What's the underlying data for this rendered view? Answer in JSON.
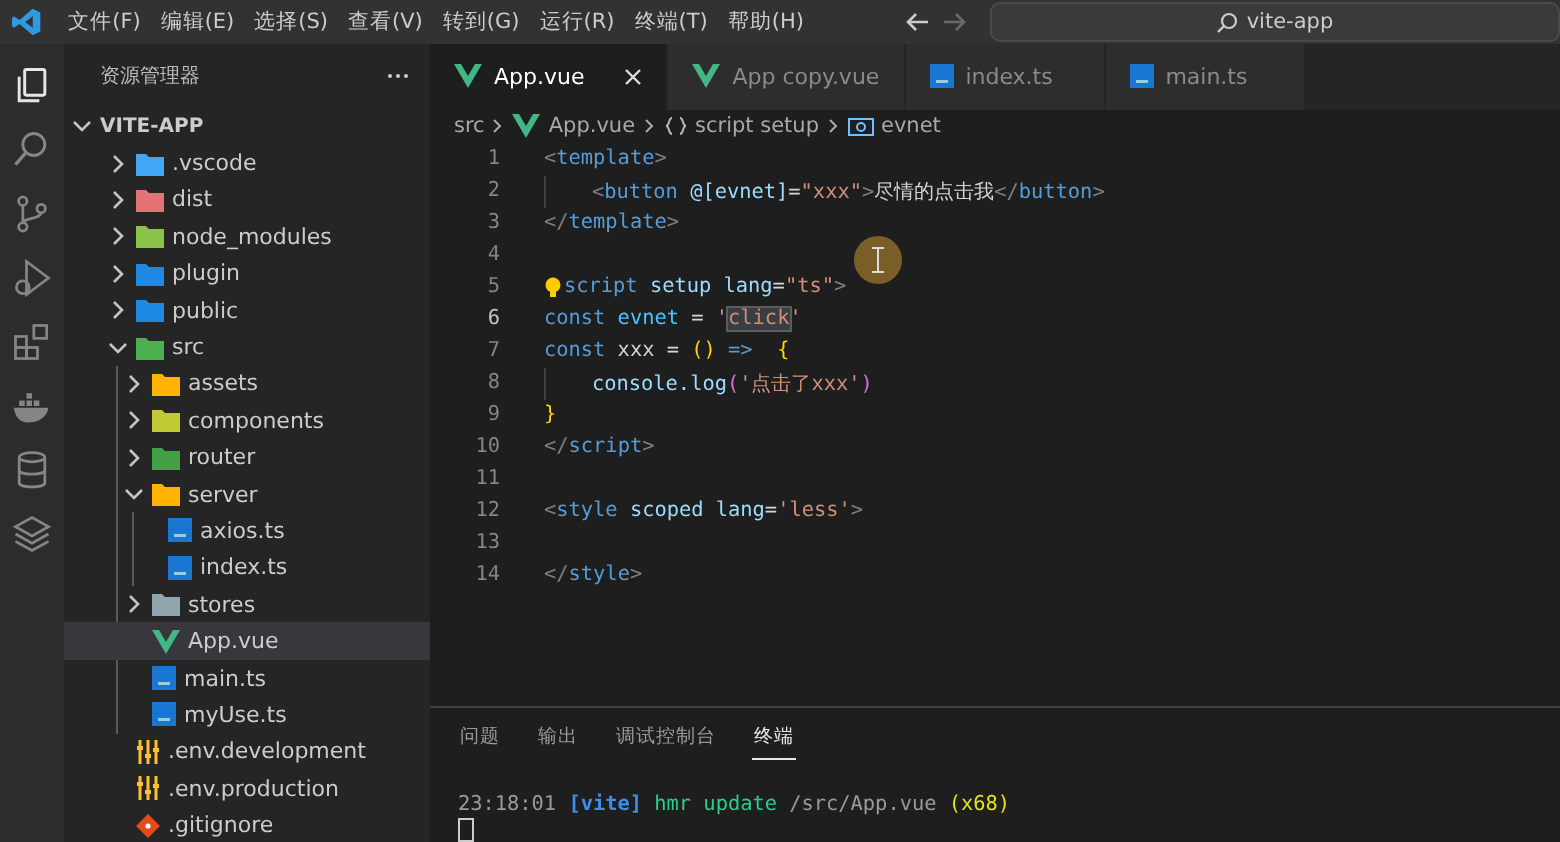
{
  "title_bar": {
    "menus": [
      "文件(F)",
      "编辑(E)",
      "选择(S)",
      "查看(V)",
      "转到(G)",
      "运行(R)",
      "终端(T)",
      "帮助(H)"
    ],
    "search": {
      "value": "vite-app"
    }
  },
  "activity_bar": [
    {
      "selected": true
    },
    {
      "selected": false
    },
    {
      "selected": false
    },
    {
      "selected": false
    },
    {
      "selected": false
    },
    {
      "selected": false
    },
    {
      "selected": false
    },
    {
      "selected": false
    }
  ],
  "sidebar": {
    "title": "资源管理器",
    "root": {
      "label": "VITE-APP",
      "expanded": true,
      "children": [
        {
          "label": ".vscode",
          "kind": "folder",
          "color": "#42a5f5",
          "expanded": false,
          "selected": false
        },
        {
          "label": "dist",
          "kind": "folder",
          "color": "#e57373",
          "expanded": false,
          "selected": false
        },
        {
          "label": "node_modules",
          "kind": "folder",
          "color": "#8bc34a",
          "expanded": false,
          "selected": false
        },
        {
          "label": "plugin",
          "kind": "folder",
          "color": "#1e88e5",
          "expanded": false,
          "selected": false
        },
        {
          "label": "public",
          "kind": "folder",
          "color": "#1e88e5",
          "expanded": false,
          "selected": false
        },
        {
          "label": "src",
          "kind": "folder",
          "color": "#4caf50",
          "expanded": true,
          "selected": false,
          "children": [
            {
              "label": "assets",
              "kind": "folder",
              "color": "#ffb300",
              "expanded": false,
              "selected": false
            },
            {
              "label": "components",
              "kind": "folder",
              "color": "#c0ca33",
              "expanded": false,
              "selected": false
            },
            {
              "label": "router",
              "kind": "folder",
              "color": "#43a047",
              "expanded": false,
              "selected": false
            },
            {
              "label": "server",
              "kind": "folder",
              "color": "#ffb300",
              "expanded": true,
              "selected": false,
              "children": [
                {
                  "label": "axios.ts",
                  "kind": "ts",
                  "selected": false
                },
                {
                  "label": "index.ts",
                  "kind": "ts",
                  "selected": false
                }
              ]
            },
            {
              "label": "stores",
              "kind": "folder",
              "color": "#90a4ae",
              "expanded": false,
              "selected": false
            },
            {
              "label": "App.vue",
              "kind": "vue",
              "selected": true
            },
            {
              "label": "main.ts",
              "kind": "ts",
              "selected": false
            },
            {
              "label": "myUse.ts",
              "kind": "ts",
              "selected": false
            }
          ]
        },
        {
          "label": ".env.development",
          "kind": "env",
          "selected": false
        },
        {
          "label": ".env.production",
          "kind": "env",
          "selected": false
        },
        {
          "label": ".gitignore",
          "kind": "git",
          "selected": false
        }
      ]
    }
  },
  "tabs": [
    {
      "label": "App.vue",
      "kind": "vue",
      "selected": true
    },
    {
      "label": "App copy.vue",
      "kind": "vue",
      "selected": false
    },
    {
      "label": "index.ts",
      "kind": "ts",
      "selected": false
    },
    {
      "label": "main.ts",
      "kind": "ts",
      "selected": false
    }
  ],
  "breadcrumb": [
    {
      "label": "src",
      "kind": "folder"
    },
    {
      "label": "App.vue",
      "kind": "vue"
    },
    {
      "label": "script setup",
      "kind": "braces"
    },
    {
      "label": "evnet",
      "kind": "variable"
    }
  ],
  "code": [
    {
      "number": "1",
      "current": false,
      "indented": false,
      "bulb": false,
      "tokens": [
        {
          "text": "<",
          "kind": "punct"
        },
        {
          "text": "template",
          "kind": "tag"
        },
        {
          "text": ">",
          "kind": "punct"
        }
      ]
    },
    {
      "number": "2",
      "current": false,
      "indented": true,
      "bulb": false,
      "tokens": [
        {
          "text": "<",
          "kind": "punct"
        },
        {
          "text": "button",
          "kind": "tag"
        },
        {
          "text": " @[evnet]",
          "kind": "attr"
        },
        {
          "text": "=",
          "kind": "plain"
        },
        {
          "text": "\"xxx\"",
          "kind": "string"
        },
        {
          "text": ">",
          "kind": "punct"
        },
        {
          "text": "尽情的点击我",
          "kind": "plain"
        },
        {
          "text": "</",
          "kind": "punct"
        },
        {
          "text": "button",
          "kind": "tag"
        },
        {
          "text": ">",
          "kind": "punct"
        }
      ]
    },
    {
      "number": "3",
      "current": false,
      "indented": false,
      "bulb": false,
      "tokens": [
        {
          "text": "</",
          "kind": "punct"
        },
        {
          "text": "template",
          "kind": "tag"
        },
        {
          "text": ">",
          "kind": "punct"
        }
      ]
    },
    {
      "number": "4",
      "current": false,
      "indented": false,
      "bulb": false
    },
    {
      "number": "5",
      "current": false,
      "indented": false,
      "bulb": true,
      "tokens": [
        {
          "text": "script",
          "kind": "tag"
        },
        {
          "text": " setup",
          "kind": "attr"
        },
        {
          "text": " lang",
          "kind": "attr"
        },
        {
          "text": "=",
          "kind": "plain"
        },
        {
          "text": "\"ts\"",
          "kind": "string"
        },
        {
          "text": ">",
          "kind": "punct"
        }
      ]
    },
    {
      "number": "6",
      "current": true,
      "indented": false,
      "bulb": false,
      "tokens": [
        {
          "text": "const",
          "kind": "keyword"
        },
        {
          "text": " evnet",
          "kind": "variable"
        },
        {
          "text": " = ",
          "kind": "plain"
        },
        {
          "text": "'",
          "kind": "string"
        },
        {
          "text": "click",
          "kind": "selected-string"
        },
        {
          "text": "'",
          "kind": "string"
        }
      ]
    },
    {
      "number": "7",
      "current": false,
      "indented": false,
      "bulb": false,
      "tokens": [
        {
          "text": "const",
          "kind": "keyword"
        },
        {
          "text": " xxx = ",
          "kind": "plain"
        },
        {
          "text": "()",
          "kind": "bracket"
        },
        {
          "text": " =>",
          "kind": "keyword"
        },
        {
          "text": "  {",
          "kind": "bracket"
        }
      ]
    },
    {
      "number": "8",
      "current": false,
      "indented": true,
      "bulb": false,
      "tokens": [
        {
          "text": "console.log",
          "kind": "attr"
        },
        {
          "text": "(",
          "kind": "bracket2"
        },
        {
          "text": "'点击了xxx'",
          "kind": "string"
        },
        {
          "text": ")",
          "kind": "bracket2"
        }
      ]
    },
    {
      "number": "9",
      "current": false,
      "indented": false,
      "bulb": false,
      "tokens": [
        {
          "text": "}",
          "kind": "bracket"
        }
      ]
    },
    {
      "number": "10",
      "current": false,
      "indented": false,
      "bulb": false,
      "tokens": [
        {
          "text": "</",
          "kind": "punct"
        },
        {
          "text": "script",
          "kind": "tag"
        },
        {
          "text": ">",
          "kind": "punct"
        }
      ]
    },
    {
      "number": "11",
      "current": false,
      "indented": false,
      "bulb": false
    },
    {
      "number": "12",
      "current": false,
      "indented": false,
      "bulb": false,
      "tokens": [
        {
          "text": "<",
          "kind": "punct"
        },
        {
          "text": "style",
          "kind": "tag"
        },
        {
          "text": " scoped",
          "kind": "attr"
        },
        {
          "text": " lang",
          "kind": "attr"
        },
        {
          "text": "=",
          "kind": "plain"
        },
        {
          "text": "'less'",
          "kind": "string"
        },
        {
          "text": ">",
          "kind": "punct"
        }
      ]
    },
    {
      "number": "13",
      "current": false,
      "indented": false,
      "bulb": false
    },
    {
      "number": "14",
      "current": false,
      "indented": false,
      "bulb": false,
      "tokens": [
        {
          "text": "</",
          "kind": "punct"
        },
        {
          "text": "style",
          "kind": "tag"
        },
        {
          "text": ">",
          "kind": "punct"
        }
      ]
    }
  ],
  "panel": {
    "tabs": [
      {
        "label": "问题",
        "selected": false
      },
      {
        "label": "输出",
        "selected": false
      },
      {
        "label": "调试控制台",
        "selected": false
      },
      {
        "label": "终端",
        "selected": true
      }
    ],
    "terminal": [
      {
        "text": "23:18:01 ",
        "kind": "time"
      },
      {
        "text": "[vite]",
        "kind": "tool"
      },
      {
        "text": " hmr update ",
        "kind": "message"
      },
      {
        "text": "/src/App.vue ",
        "kind": "path"
      },
      {
        "text": "(x68)",
        "kind": "count"
      }
    ]
  }
}
